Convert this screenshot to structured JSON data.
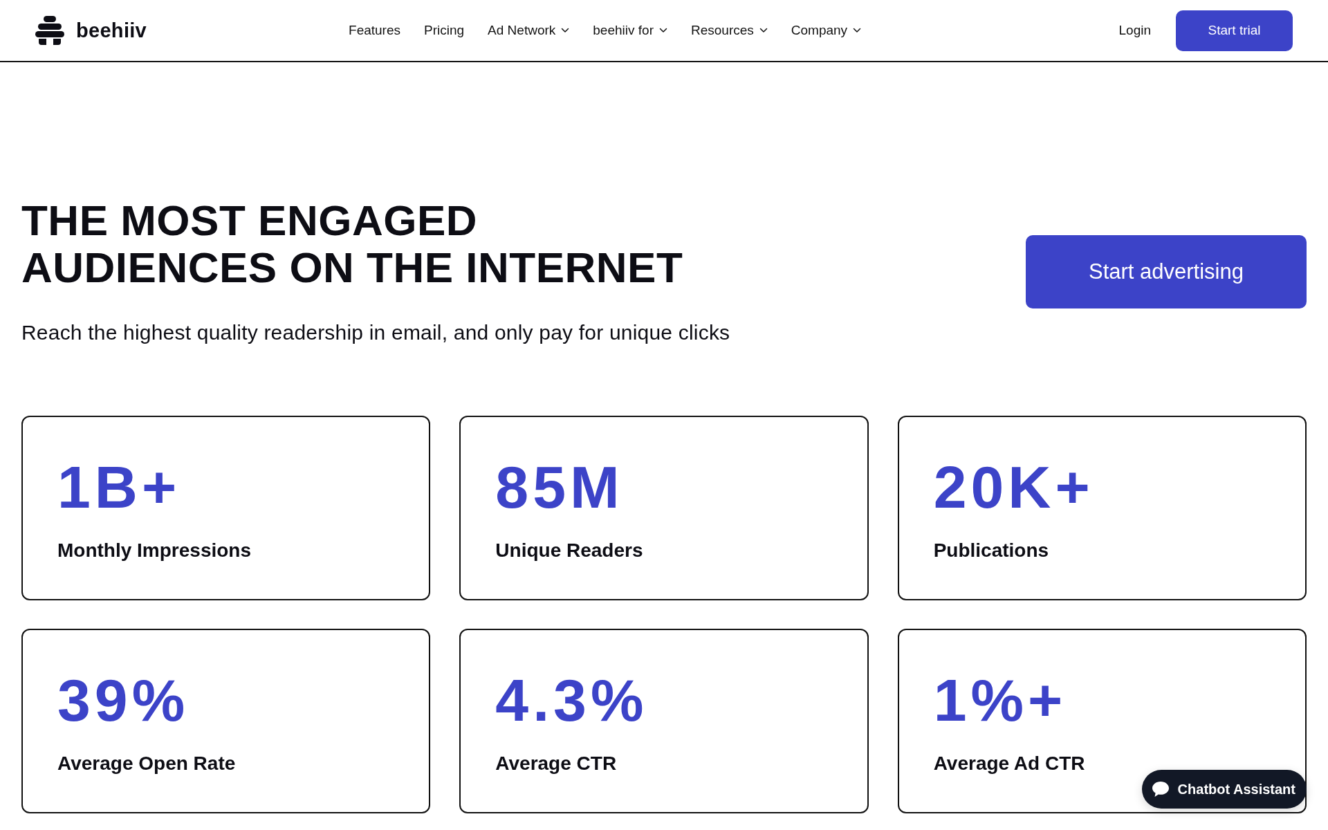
{
  "header": {
    "brand": "beehiiv",
    "nav": [
      {
        "label": "Features",
        "has_menu": false
      },
      {
        "label": "Pricing",
        "has_menu": false
      },
      {
        "label": "Ad Network",
        "has_menu": true
      },
      {
        "label": "beehiiv for",
        "has_menu": true
      },
      {
        "label": "Resources",
        "has_menu": true
      },
      {
        "label": "Company",
        "has_menu": true
      }
    ],
    "login": "Login",
    "cta": "Start trial"
  },
  "hero": {
    "title": "THE MOST ENGAGED AUDIENCES ON THE INTERNET",
    "subtitle": "Reach the highest quality readership in email, and only pay for unique clicks",
    "cta": "Start advertising"
  },
  "stats": [
    {
      "value": "1B+",
      "label": "Monthly Impressions"
    },
    {
      "value": "85M",
      "label": "Unique Readers"
    },
    {
      "value": "20K+",
      "label": "Publications"
    },
    {
      "value": "39%",
      "label": "Average Open Rate"
    },
    {
      "value": "4.3%",
      "label": "Average CTR"
    },
    {
      "value": "1%+",
      "label": "Average Ad CTR"
    }
  ],
  "chat_widget": {
    "label": "Chatbot Assistant"
  }
}
